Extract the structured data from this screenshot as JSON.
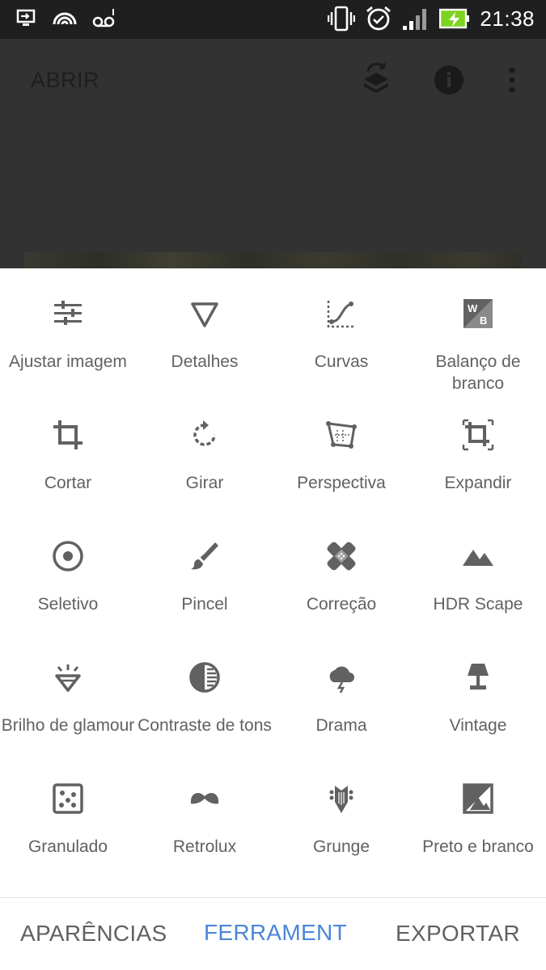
{
  "status_bar": {
    "time": "21:38",
    "icons": [
      "screen-cast-icon",
      "hotspot-icon",
      "voicemail-icon",
      "vibrate-icon",
      "alarm-icon",
      "signal-icon",
      "battery-charging-icon"
    ]
  },
  "top_bar": {
    "title": "ABRIR",
    "icons": [
      "layers-rotate-icon",
      "info-icon",
      "more-vert-icon"
    ]
  },
  "tools": [
    {
      "label": "Ajustar imagem",
      "icon": "tune-icon"
    },
    {
      "label": "Detalhes",
      "icon": "triangle-icon"
    },
    {
      "label": "Curvas",
      "icon": "curves-icon"
    },
    {
      "label": "Balanço de branco",
      "icon": "white-balance-icon"
    },
    {
      "label": "Cortar",
      "icon": "crop-icon"
    },
    {
      "label": "Girar",
      "icon": "rotate-icon"
    },
    {
      "label": "Perspectiva",
      "icon": "perspective-icon"
    },
    {
      "label": "Expandir",
      "icon": "expand-icon"
    },
    {
      "label": "Seletivo",
      "icon": "selective-icon"
    },
    {
      "label": "Pincel",
      "icon": "brush-icon"
    },
    {
      "label": "Correção",
      "icon": "healing-icon"
    },
    {
      "label": "HDR Scape",
      "icon": "mountain-icon"
    },
    {
      "label": "Brilho de glamour",
      "icon": "diamond-icon"
    },
    {
      "label": "Contraste de tons",
      "icon": "tonal-contrast-icon"
    },
    {
      "label": "Drama",
      "icon": "storm-cloud-icon"
    },
    {
      "label": "Vintage",
      "icon": "lamp-icon"
    },
    {
      "label": "Granulado",
      "icon": "grain-icon"
    },
    {
      "label": "Retrolux",
      "icon": "mustache-icon"
    },
    {
      "label": "Grunge",
      "icon": "guitar-head-icon"
    },
    {
      "label": "Preto e branco",
      "icon": "black-white-icon"
    }
  ],
  "bottom_nav": {
    "tabs": [
      "APARÊNCIAS",
      "FERRAMENT",
      "EXPORTAR"
    ],
    "active_index": 1,
    "active_color": "#4a86d8"
  },
  "colors": {
    "icon_gray": "#616161",
    "overlay_dark": "#323232",
    "status_bar": "#1f1f1f",
    "battery_green": "#7ed321"
  }
}
